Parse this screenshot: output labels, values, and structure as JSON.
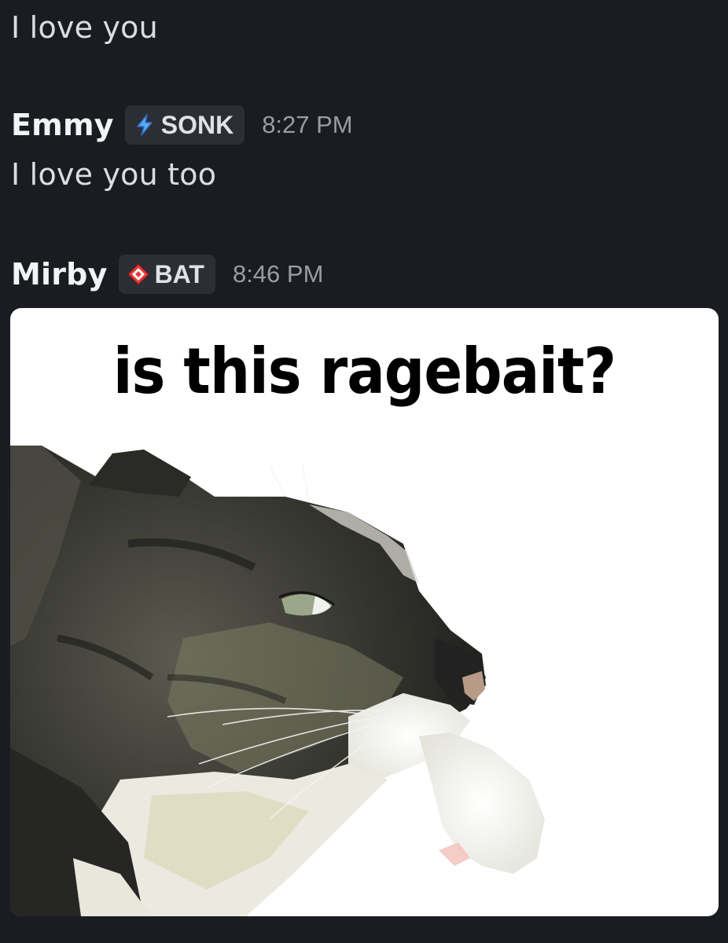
{
  "messages": [
    {
      "text": "I love you"
    },
    {
      "username": "Emmy",
      "tag": "SONK",
      "tag_icon": "lightning-bolt-icon",
      "timestamp": "8:27 PM",
      "text": "I love you too"
    },
    {
      "username": "Mirby",
      "tag": "BAT",
      "tag_icon": "diamond-target-icon",
      "timestamp": "8:46 PM",
      "attachment": {
        "caption": "is this ragebait?",
        "image_subject": "thinking-cat-photo"
      }
    }
  ],
  "colors": {
    "background": "#1b1c21",
    "message_text": "#dcdde1",
    "username": "#f2f3f5",
    "tag_background": "#2c2e35",
    "timestamp": "#9b9ca3",
    "sonk_icon": "#5aa9f5",
    "bat_icon": "#e23a3a"
  }
}
